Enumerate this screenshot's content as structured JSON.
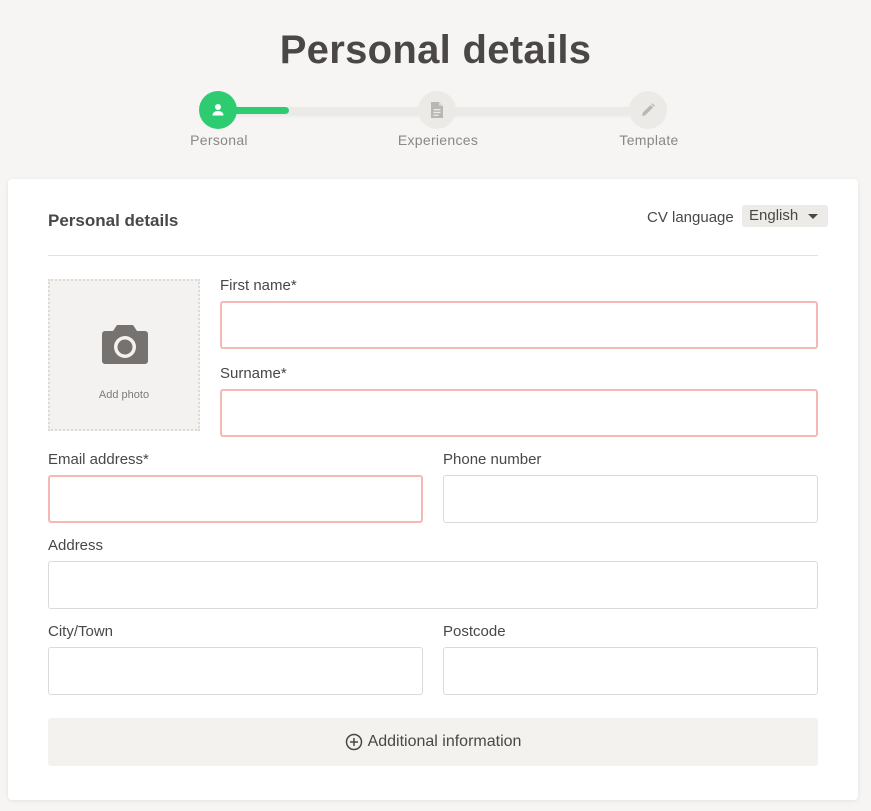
{
  "page": {
    "title": "Personal details"
  },
  "steps": [
    {
      "label": "Personal",
      "icon": "person-icon",
      "active": true
    },
    {
      "label": "Experiences",
      "icon": "document-icon",
      "active": false
    },
    {
      "label": "Template",
      "icon": "pencil-icon",
      "active": false
    }
  ],
  "form": {
    "section_title": "Personal details",
    "cv_language_label": "CV language",
    "cv_language_value": "English",
    "photo": {
      "label": "Add photo",
      "icon": "camera-icon"
    },
    "fields": {
      "first_name": {
        "label": "First name*",
        "value": ""
      },
      "surname": {
        "label": "Surname*",
        "value": ""
      },
      "email": {
        "label": "Email address*",
        "value": ""
      },
      "phone": {
        "label": "Phone number",
        "value": ""
      },
      "address": {
        "label": "Address",
        "value": ""
      },
      "city": {
        "label": "City/Town",
        "value": ""
      },
      "postcode": {
        "label": "Postcode",
        "value": ""
      }
    },
    "additional_button": {
      "label": "Additional information",
      "icon": "plus-circle-icon"
    }
  },
  "colors": {
    "accent": "#2ecc71",
    "error_border": "#f4b9b5",
    "text": "#4a4746"
  }
}
